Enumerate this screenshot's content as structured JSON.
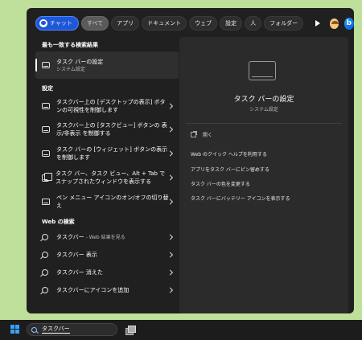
{
  "filters": {
    "chat": "チャット",
    "items": [
      "すべて",
      "アプリ",
      "ドキュメント",
      "ウェブ",
      "設定",
      "人",
      "フォルダー"
    ]
  },
  "left": {
    "best_match_heading": "最も一致する検索結果",
    "best_match": {
      "title": "タスク バーの設定",
      "subtitle": "システム設定"
    },
    "settings_heading": "設定",
    "settings": [
      {
        "line1": "タスクバー上の [デスクトップの表示] ボタ",
        "line2": "ンの可視性を制御します",
        "icon": "taskbar-icon"
      },
      {
        "line1": "タスクバー上の [タスクビュー] ボタンの 表",
        "line2": "示/非表示 を制御する",
        "icon": "taskbar-icon"
      },
      {
        "line1": "タスク バーの [ウィジェット] ボタンの表示",
        "line2": "を制御します",
        "icon": "taskbar-icon"
      },
      {
        "line1": "タスク バー、タスク ビュー、Alt + Tab で",
        "line2": "スナップされたウィンドウを表示する",
        "icon": "snap-windows-icon"
      },
      {
        "line1": "ペン メニュー アイコンのオン/オフの切り替",
        "line2": "え",
        "icon": "pen-icon"
      }
    ],
    "web_heading": "Web の検索",
    "web": [
      {
        "bold": "タスクバー",
        "rest": " - Web 結果を見る"
      },
      {
        "bold": "タスクバー 表示",
        "rest": ""
      },
      {
        "bold": "タスクバー 消えた",
        "rest": ""
      },
      {
        "bold": "タスクバーにアイコンを追加",
        "rest": ""
      }
    ]
  },
  "preview": {
    "title": "タスク バーの設定",
    "subtitle": "システム設定",
    "open": "開く",
    "actions": [
      "Web のクイック ヘルプを利用する",
      "アプリをタスク バーにピン留めする",
      "タスク バーの色を変更する",
      "タスク バーにバッテリー アイコンを表示する"
    ]
  },
  "taskbar": {
    "query": "タスクバー"
  },
  "colors": {
    "accent": "#1e57d8",
    "desktop": "#bfe09a",
    "panel": "#202020"
  }
}
